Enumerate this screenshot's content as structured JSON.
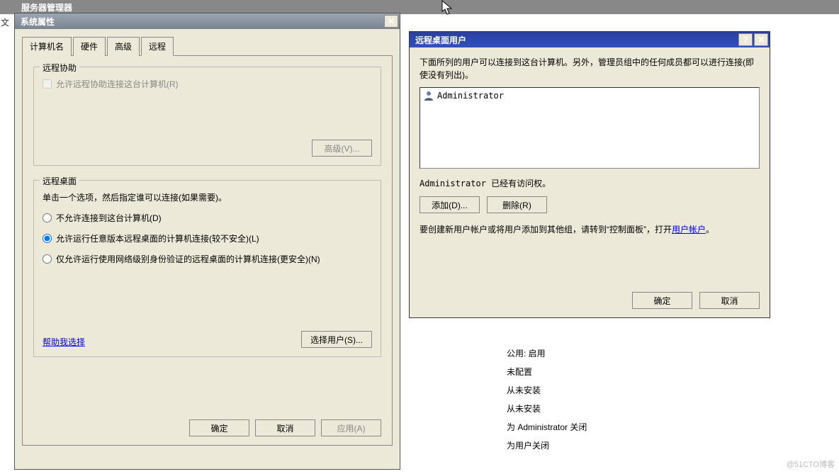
{
  "background": {
    "app_title": "服务器管理器",
    "status_lines": [
      "公用: 启用",
      "未配置",
      "从未安装",
      "从未安装",
      "为 Administrator 关闭",
      "为用户关闭"
    ]
  },
  "sysprops": {
    "title": "系统属性",
    "tabs": {
      "computer_name": "计算机名",
      "hardware": "硬件",
      "advanced": "高级",
      "remote": "远程"
    },
    "remote_assist": {
      "legend": "远程协助",
      "checkbox": "允许远程协助连接这台计算机(R)",
      "advanced_btn": "高级(V)..."
    },
    "remote_desktop": {
      "legend": "远程桌面",
      "hint": "单击一个选项，然后指定谁可以连接(如果需要)。",
      "opt1": "不允许连接到这台计算机(D)",
      "opt2": "允许运行任意版本远程桌面的计算机连接(较不安全)(L)",
      "opt3": "仅允许运行使用网络级别身份验证的远程桌面的计算机连接(更安全)(N)",
      "help_link": "帮助我选择",
      "select_users_btn": "选择用户(S)..."
    },
    "buttons": {
      "ok": "确定",
      "cancel": "取消",
      "apply": "应用(A)"
    }
  },
  "rdusers": {
    "title": "远程桌面用户",
    "intro": "下面所列的用户可以连接到这台计算机。另外，管理员组中的任何成员都可以进行连接(即使没有列出)。",
    "list": [
      "Administrator"
    ],
    "access_msg": "Administrator 已经有访问权。",
    "add_btn": "添加(D)...",
    "remove_btn": "删除(R)",
    "create_msg_prefix": "要创建新用户帐户或将用户添加到其他组，请转到“控制面板”，打开",
    "user_accounts_link": "用户帐户",
    "create_msg_suffix": "。",
    "ok": "确定",
    "cancel": "取消"
  },
  "watermark": "@51CTO博客",
  "leftlabel": "文"
}
